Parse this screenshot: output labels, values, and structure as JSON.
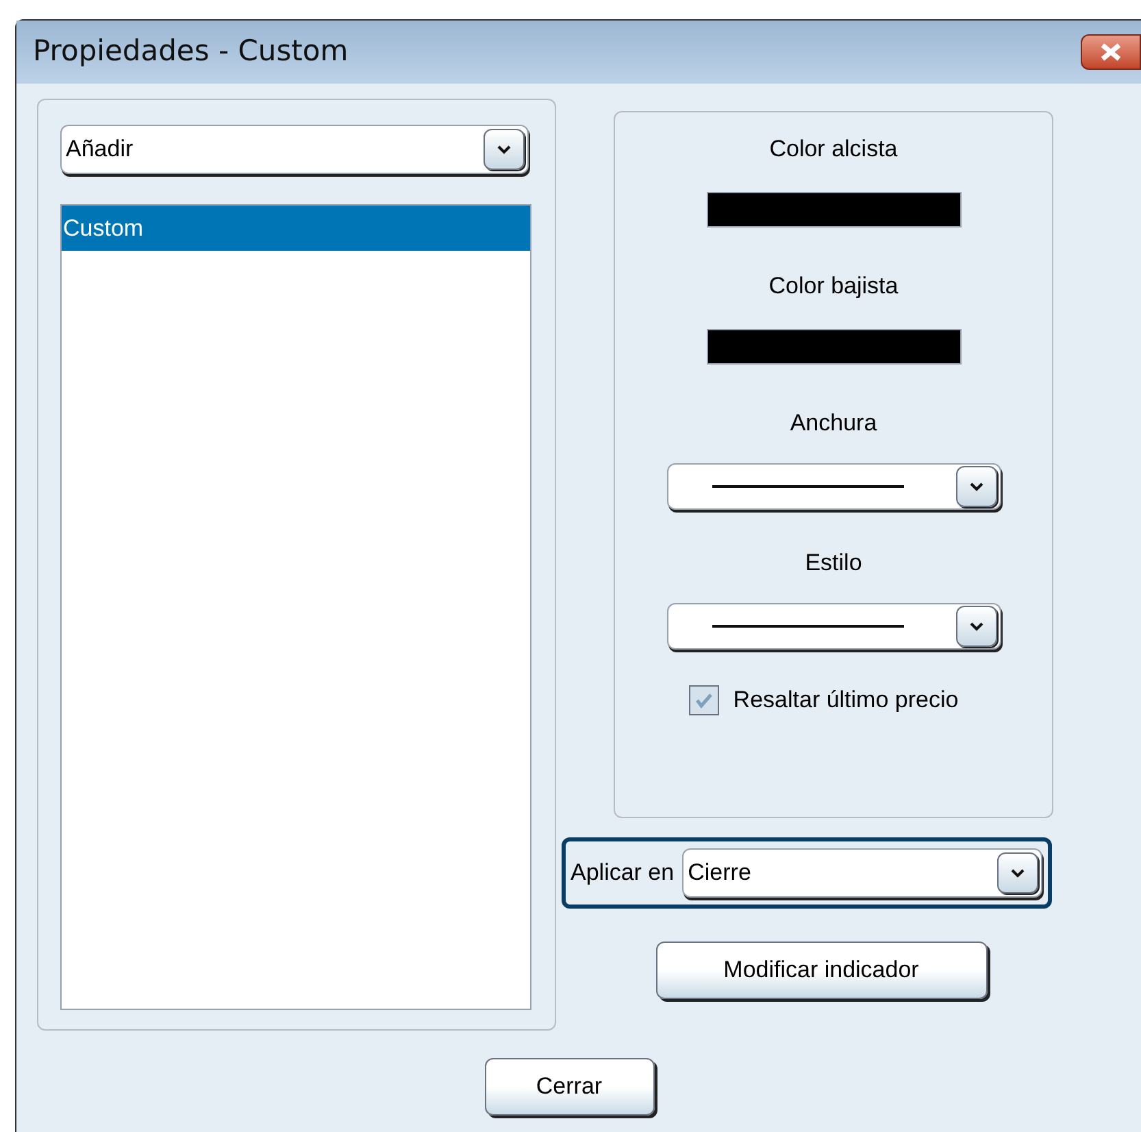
{
  "window": {
    "title": "Propiedades - Custom"
  },
  "left_panel": {
    "dropdown": {
      "value": "Añadir"
    },
    "list": {
      "items": [
        {
          "label": "Custom",
          "selected": true
        }
      ]
    }
  },
  "right_group": {
    "up_color": {
      "label": "Color alcista",
      "color": "#000000"
    },
    "down_color": {
      "label": "Color bajista",
      "color": "#000000"
    },
    "width": {
      "label": "Anchura"
    },
    "style": {
      "label": "Estilo"
    },
    "highlight_last_price": {
      "label": "Resaltar último precio",
      "checked": true
    }
  },
  "apply_on": {
    "label": "Aplicar en",
    "value": "Cierre"
  },
  "buttons": {
    "modify": "Modificar indicador",
    "close": "Cerrar"
  }
}
